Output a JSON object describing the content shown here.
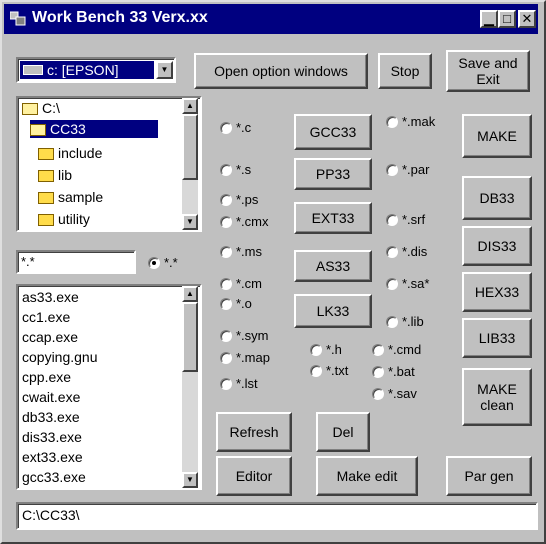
{
  "window": {
    "title": "Work Bench 33 Verx.xx"
  },
  "drive": {
    "value": "c: [EPSON]"
  },
  "top_buttons": {
    "open_option": "Open option windows",
    "stop": "Stop",
    "save_exit": "Save and Exit"
  },
  "folders": [
    {
      "label": "C:\\"
    },
    {
      "label": "CC33",
      "selected": true
    },
    {
      "label": "include"
    },
    {
      "label": "lib"
    },
    {
      "label": "sample"
    },
    {
      "label": "utility"
    }
  ],
  "filter": {
    "value": "*.*",
    "radio_label": "*.*"
  },
  "files": [
    "as33.exe",
    "cc1.exe",
    "ccap.exe",
    "copying.gnu",
    "cpp.exe",
    "cwait.exe",
    "db33.exe",
    "dis33.exe",
    "ext33.exe",
    "gcc33.exe"
  ],
  "radios": {
    "c": "*.c",
    "s": "*.s",
    "ps": "*.ps",
    "cmx": "*.cmx",
    "ms": "*.ms",
    "cm": "*.cm",
    "o": "*.o",
    "sym": "*.sym",
    "map": "*.map",
    "lst": "*.lst",
    "h": "*.h",
    "txt": "*.txt",
    "mak": "*.mak",
    "par": "*.par",
    "srf": "*.srf",
    "dis": "*.dis",
    "sa": "*.sa*",
    "lib": "*.lib",
    "cmd": "*.cmd",
    "bat": "*.bat",
    "sav": "*.sav"
  },
  "tools": {
    "gcc33": "GCC33",
    "pp33": "PP33",
    "ext33": "EXT33",
    "as33": "AS33",
    "lk33": "LK33"
  },
  "right_buttons": {
    "make": "MAKE",
    "db33": "DB33",
    "dis33": "DIS33",
    "hex33": "HEX33",
    "lib33": "LIB33",
    "make_clean": "MAKE clean"
  },
  "actions": {
    "refresh": "Refresh",
    "del": "Del",
    "editor": "Editor",
    "make_edit": "Make edit",
    "par_gen": "Par gen"
  },
  "status": {
    "path": "C:\\CC33\\"
  }
}
